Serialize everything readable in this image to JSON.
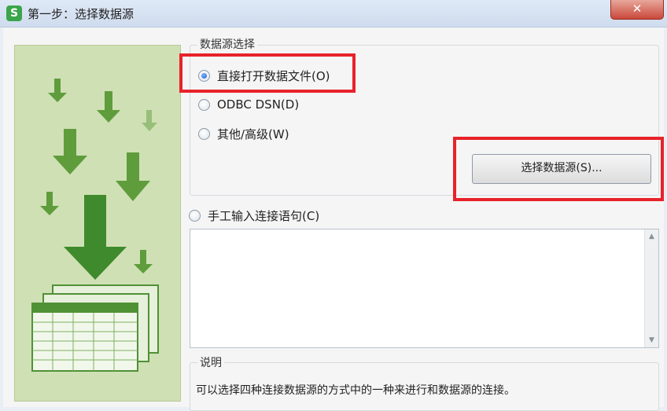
{
  "window": {
    "title": "第一步：选择数据源",
    "app_icon": "S",
    "close_label": "✕"
  },
  "datasource_group": {
    "legend": "数据源选择",
    "options": [
      {
        "label": "直接打开数据文件(O)",
        "checked": true
      },
      {
        "label": "ODBC DSN(D)",
        "checked": false
      },
      {
        "label": "其他/高级(W)",
        "checked": false
      }
    ],
    "select_button_label": "选择数据源(S)..."
  },
  "manual": {
    "label": "手工输入连接语句(C)",
    "checked": false,
    "value": ""
  },
  "description": {
    "legend": "说明",
    "text": "可以选择四种连接数据源的方式中的一种来进行和数据源的连接。"
  },
  "colors": {
    "accent": "#3aa54a",
    "highlight": "#e8222a",
    "art_background": "#cfe0b4"
  }
}
